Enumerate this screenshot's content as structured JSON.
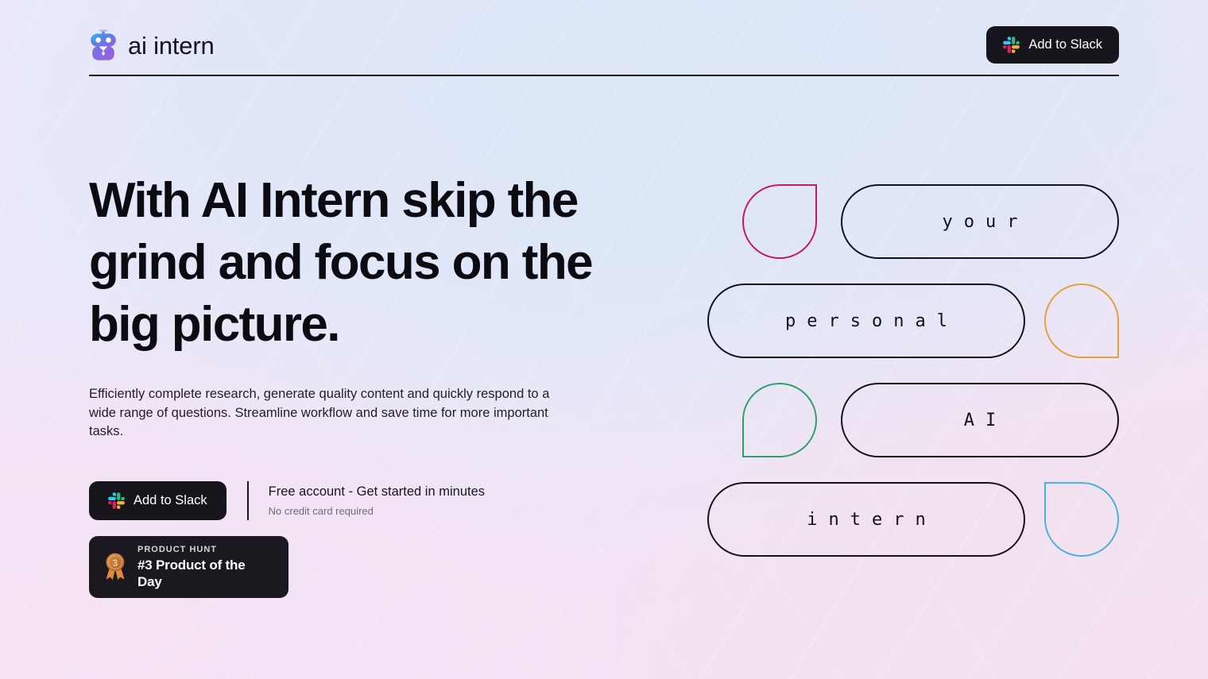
{
  "header": {
    "brand_name": "ai intern",
    "brand_logo_icon": "robot-logo-icon",
    "cta_label": "Add to Slack",
    "cta_icon": "slack-icon"
  },
  "hero": {
    "headline": "With AI Intern skip the grind and focus on the big picture.",
    "subhead": "Efficiently complete research, generate quality content and quickly respond to a wide range of questions. Streamline workflow and save time for more important tasks.",
    "cta": {
      "button_label": "Add to Slack",
      "button_icon": "slack-icon",
      "note_title": "Free account - Get started in minutes",
      "note_sub": "No credit card required"
    },
    "product_hunt": {
      "icon": "medal-icon",
      "kicker": "PRODUCT HUNT",
      "title": "#3 Product of the Day",
      "rank": "3"
    }
  },
  "graphic": {
    "rows": [
      {
        "drop_position": "left",
        "drop_shape": "tr-square",
        "drop_color": "#c8175e",
        "pill_text": "your",
        "pill_width": 350
      },
      {
        "drop_position": "right",
        "drop_shape": "br-square",
        "drop_color": "#e2a13e",
        "pill_text": "personal",
        "pill_width": 400
      },
      {
        "drop_position": "left",
        "drop_shape": "bl-square",
        "drop_color": "#2fa06a",
        "pill_text": "AI",
        "pill_width": 350
      },
      {
        "drop_position": "right",
        "drop_shape": "tl-square",
        "drop_color": "#4bafe0",
        "pill_text": "intern",
        "pill_width": 400
      }
    ]
  },
  "colors": {
    "ink": "#13111a",
    "button_bg": "#17151c",
    "badge_bg": "#1b181f",
    "muted_text": "#6d6b7a",
    "bg_lavender": "#ece9f9",
    "bg_blue": "#dbe6f7",
    "bg_pink": "#f5e3f2"
  }
}
